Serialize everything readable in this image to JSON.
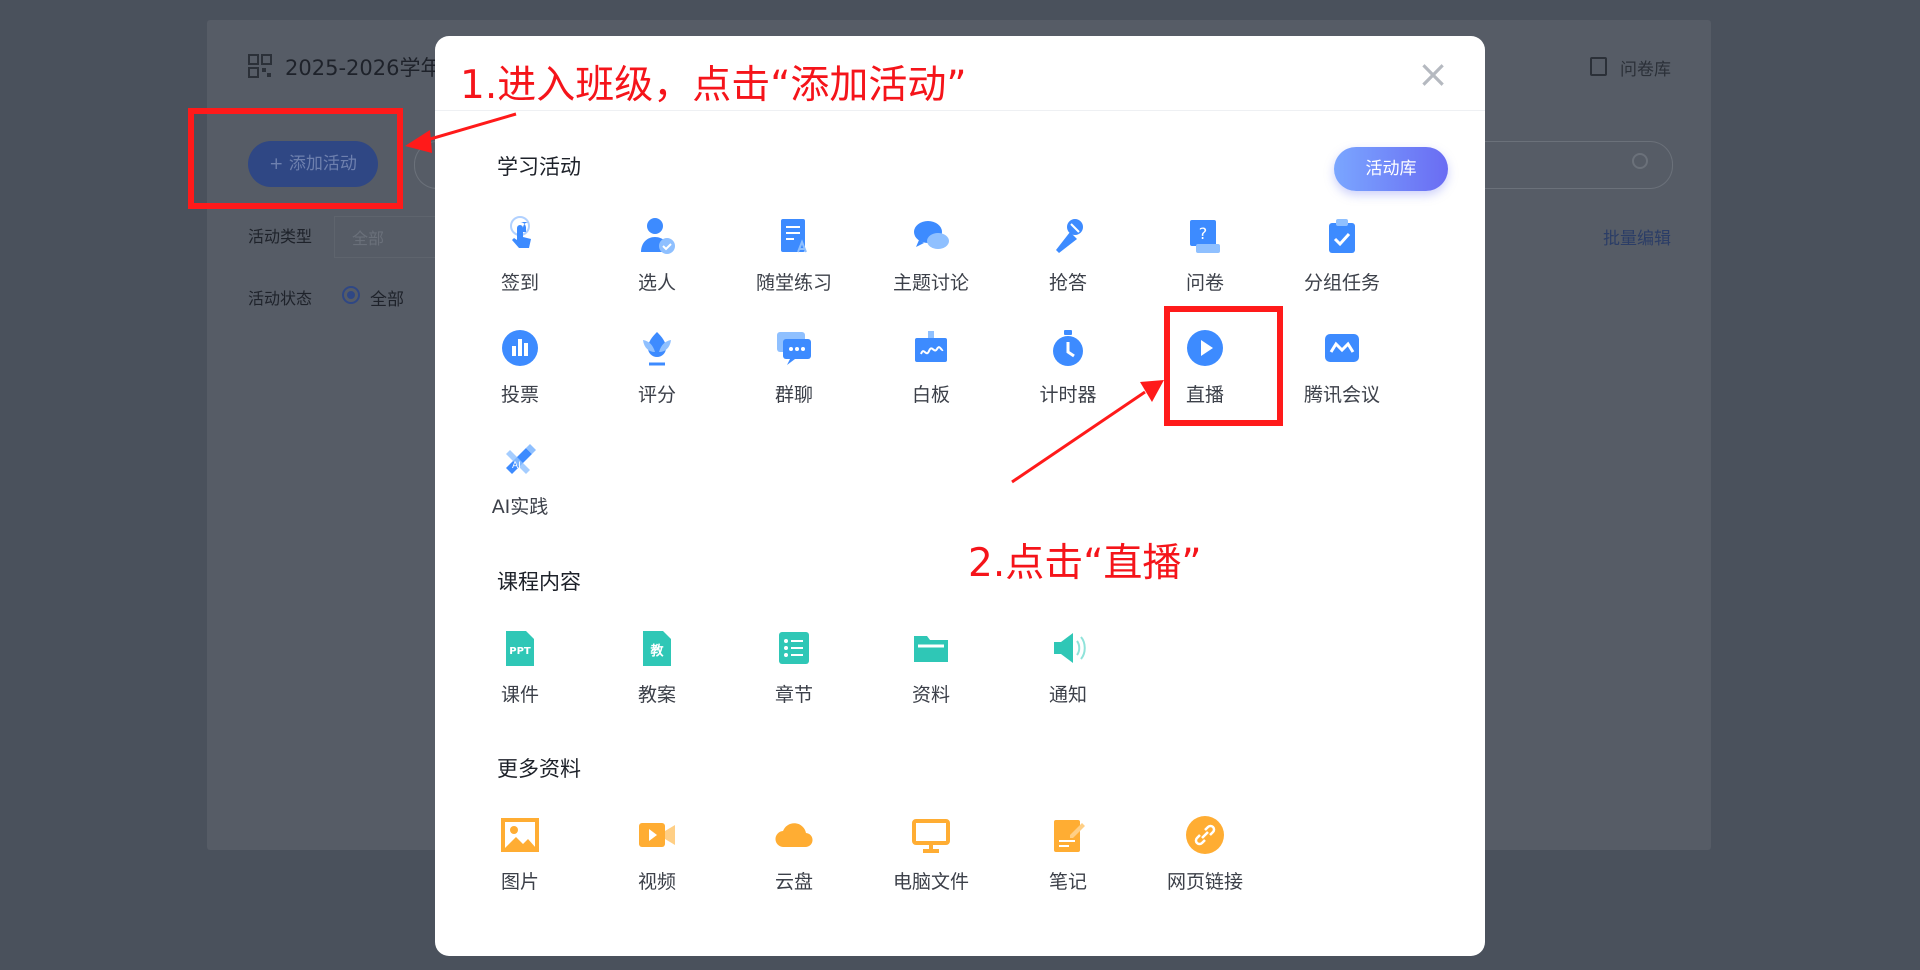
{
  "background_page": {
    "title": "2025-2026学年",
    "survey_link": "问卷库",
    "add_activity_button": "+ 添加活动",
    "filter_type_label": "活动类型",
    "filter_type_value": "全部",
    "batch_edit": "批量编辑",
    "filter_status_label": "活动状态",
    "filter_status_value": "全部"
  },
  "modal": {
    "close_icon": "close-icon",
    "library_button": "活动库",
    "sections": [
      {
        "title": "学习活动",
        "items": [
          {
            "label": "签到",
            "icon": "checkin-icon",
            "color": "#3d8bff"
          },
          {
            "label": "选人",
            "icon": "pick-person-icon",
            "color": "#3d8bff"
          },
          {
            "label": "随堂练习",
            "icon": "quiz-icon",
            "color": "#3d8bff"
          },
          {
            "label": "主题讨论",
            "icon": "discussion-icon",
            "color": "#3d8bff"
          },
          {
            "label": "抢答",
            "icon": "microphone-icon",
            "color": "#3d8bff"
          },
          {
            "label": "问卷",
            "icon": "questionnaire-icon",
            "color": "#3d8bff"
          },
          {
            "label": "分组任务",
            "icon": "group-task-icon",
            "color": "#3d8bff"
          },
          {
            "label": "投票",
            "icon": "vote-icon",
            "color": "#3d8bff"
          },
          {
            "label": "评分",
            "icon": "rating-icon",
            "color": "#3d8bff"
          },
          {
            "label": "群聊",
            "icon": "group-chat-icon",
            "color": "#3d8bff"
          },
          {
            "label": "白板",
            "icon": "whiteboard-icon",
            "color": "#3d8bff"
          },
          {
            "label": "计时器",
            "icon": "timer-icon",
            "color": "#3d8bff"
          },
          {
            "label": "直播",
            "icon": "live-play-icon",
            "color": "#3d8bff"
          },
          {
            "label": "腾讯会议",
            "icon": "tencent-meeting-icon",
            "color": "#3d8bff"
          },
          {
            "label": "AI实践",
            "icon": "ai-practice-icon",
            "color": "#3d8bff"
          }
        ]
      },
      {
        "title": "课程内容",
        "items": [
          {
            "label": "课件",
            "icon": "ppt-icon",
            "color": "#2fc7b6"
          },
          {
            "label": "教案",
            "icon": "lesson-plan-icon",
            "color": "#2fc7b6"
          },
          {
            "label": "章节",
            "icon": "chapter-icon",
            "color": "#2fc7b6"
          },
          {
            "label": "资料",
            "icon": "folder-icon",
            "color": "#2fc7b6"
          },
          {
            "label": "通知",
            "icon": "announcement-icon",
            "color": "#2fc7b6"
          }
        ]
      },
      {
        "title": "更多资料",
        "items": [
          {
            "label": "图片",
            "icon": "image-icon",
            "color": "#ffad33"
          },
          {
            "label": "视频",
            "icon": "video-icon",
            "color": "#ffad33"
          },
          {
            "label": "云盘",
            "icon": "cloud-icon",
            "color": "#ffad33"
          },
          {
            "label": "电脑文件",
            "icon": "computer-icon",
            "color": "#ffad33"
          },
          {
            "label": "笔记",
            "icon": "note-icon",
            "color": "#ffad33"
          },
          {
            "label": "网页链接",
            "icon": "link-icon",
            "color": "#ffad33"
          }
        ]
      }
    ]
  },
  "annotations": {
    "step1": "1.进入班级，点击“添加活动”",
    "step2": "2.点击“直播”",
    "color": "#ff1a1a"
  }
}
